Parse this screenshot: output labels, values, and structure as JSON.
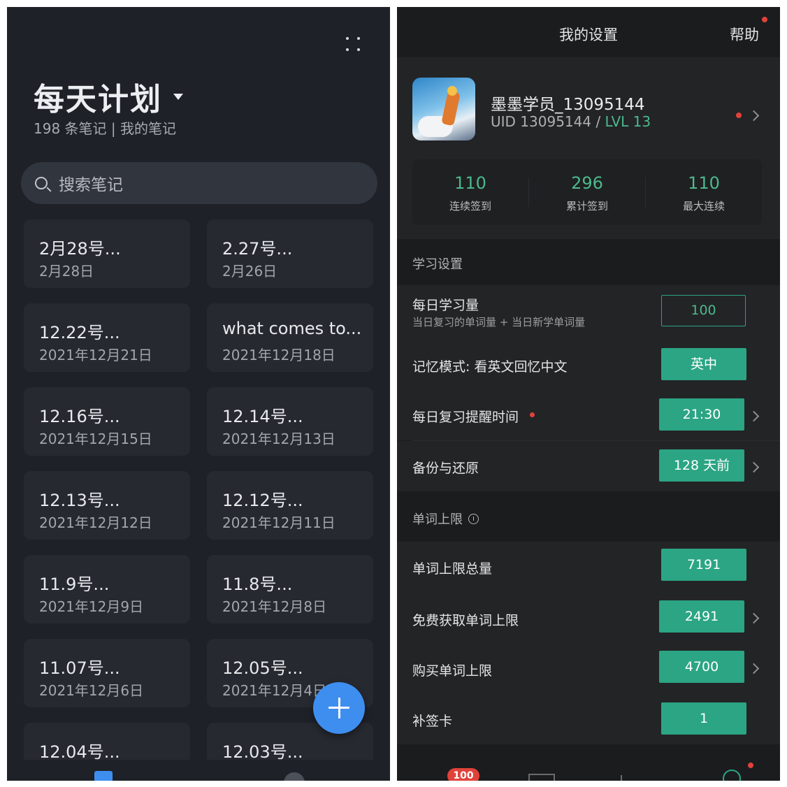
{
  "left": {
    "title": "每天计划",
    "subtitle": "198 条笔记 | 我的笔记",
    "search_placeholder": "搜索笔记",
    "notes": [
      {
        "title": "2月28号...",
        "date": "2月28日"
      },
      {
        "title": "2.27号...",
        "date": "2月26日"
      },
      {
        "title": "12.22号...",
        "date": "2021年12月21日"
      },
      {
        "title": "what comes to...",
        "date": "2021年12月18日"
      },
      {
        "title": "12.16号...",
        "date": "2021年12月15日"
      },
      {
        "title": "12.14号...",
        "date": "2021年12月13日"
      },
      {
        "title": "12.13号...",
        "date": "2021年12月12日"
      },
      {
        "title": "12.12号...",
        "date": "2021年12月11日"
      },
      {
        "title": "11.9号...",
        "date": "2021年12月9日"
      },
      {
        "title": "11.8号...",
        "date": "2021年12月8日"
      },
      {
        "title": "11.07号...",
        "date": "2021年12月6日"
      },
      {
        "title": "12.05号...",
        "date": "2021年12月4日"
      },
      {
        "title": "12.04号...",
        "date": ""
      },
      {
        "title": "12.03号...",
        "date": ""
      }
    ],
    "accent": "#3e8ef0"
  },
  "right": {
    "header_title": "我的设置",
    "help_label": "帮助",
    "profile": {
      "username": "墨墨学员_13095144",
      "uid_text": "UID 13095144 / ",
      "level": "LVL 13"
    },
    "stats": [
      {
        "value": "110",
        "label": "连续签到"
      },
      {
        "value": "296",
        "label": "累计签到"
      },
      {
        "value": "110",
        "label": "最大连续"
      }
    ],
    "study_section": "学习设置",
    "daily_amount": {
      "label": "每日学习量",
      "sub": "当日复习的单词量 + 当日新学单词量",
      "value": "100"
    },
    "memory_mode": {
      "label": "记忆模式:  看英文回忆中文",
      "value": "英中"
    },
    "review_time": {
      "label": "每日复习提醒时间",
      "value": "21:30"
    },
    "backup": {
      "label": "备份与还原",
      "value": "128 天前"
    },
    "limit_section": "单词上限",
    "word_limit_total": {
      "label": "单词上限总量",
      "value": "7191"
    },
    "free_limit": {
      "label": "免费获取单词上限",
      "value": "2491"
    },
    "buy_limit": {
      "label": "购买单词上限",
      "value": "4700"
    },
    "makeup_card": {
      "label": "补签卡",
      "value": "1"
    },
    "nav_badge": "100",
    "accent": "#2ba584"
  }
}
